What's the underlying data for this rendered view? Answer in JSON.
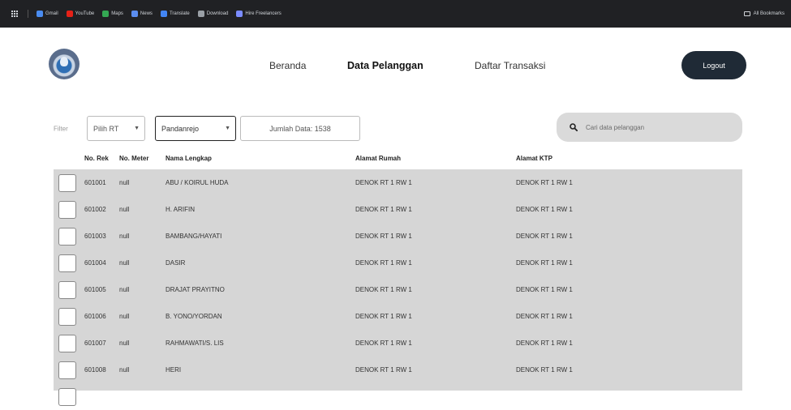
{
  "browser": {
    "bookmarks": [
      {
        "label": "Gmail",
        "color": "#4a8cf0"
      },
      {
        "label": "YouTube",
        "color": "#e62117"
      },
      {
        "label": "Maps",
        "color": "#34a853"
      },
      {
        "label": "News",
        "color": "#5b8def"
      },
      {
        "label": "Translate",
        "color": "#4285f4"
      },
      {
        "label": "Download",
        "color": "#9aa0a6"
      },
      {
        "label": "Hire Freelancers",
        "color": "#7b8cff"
      }
    ],
    "all_bookmarks_label": "All Bookmarks"
  },
  "nav": {
    "links": [
      "Beranda",
      "Data Pelanggan",
      "Daftar Transaksi"
    ],
    "active": "Data Pelanggan",
    "logout_label": "Logout"
  },
  "filter": {
    "label": "Filter",
    "rt_select": "Pilih RT",
    "area_select": "Pandanrejo",
    "count_text": "Jumlah Data: 1538"
  },
  "search": {
    "placeholder": "Cari data pelanggan"
  },
  "table": {
    "columns": [
      "No. Rek",
      "No. Meter",
      "Nama Lengkap",
      "Alamat Rumah",
      "Alamat KTP"
    ],
    "rows": [
      {
        "rek": "601001",
        "meter": "null",
        "nama": "ABU / KOIRUL HUDA",
        "alamat": "DENOK RT 1 RW 1",
        "ktp": "DENOK RT 1 RW 1"
      },
      {
        "rek": "601002",
        "meter": "null",
        "nama": "H. ARIFIN",
        "alamat": "DENOK RT 1 RW 1",
        "ktp": "DENOK RT 1 RW 1"
      },
      {
        "rek": "601003",
        "meter": "null",
        "nama": "BAMBANG/HAYATI",
        "alamat": "DENOK RT 1 RW 1",
        "ktp": "DENOK RT 1 RW 1"
      },
      {
        "rek": "601004",
        "meter": "null",
        "nama": "DASIR",
        "alamat": "DENOK RT 1 RW 1",
        "ktp": "DENOK RT 1 RW 1"
      },
      {
        "rek": "601005",
        "meter": "null",
        "nama": "DRAJAT PRAYITNO",
        "alamat": "DENOK RT 1 RW 1",
        "ktp": "DENOK RT 1 RW 1"
      },
      {
        "rek": "601006",
        "meter": "null",
        "nama": "B. YONO/YORDAN",
        "alamat": "DENOK RT 1 RW 1",
        "ktp": "DENOK RT 1 RW 1"
      },
      {
        "rek": "601007",
        "meter": "null",
        "nama": "RAHMAWATI/S. LIS",
        "alamat": "DENOK RT 1 RW 1",
        "ktp": "DENOK RT 1 RW 1"
      },
      {
        "rek": "601008",
        "meter": "null",
        "nama": "HERI",
        "alamat": "DENOK RT 1 RW 1",
        "ktp": "DENOK RT 1 RW 1"
      }
    ]
  }
}
